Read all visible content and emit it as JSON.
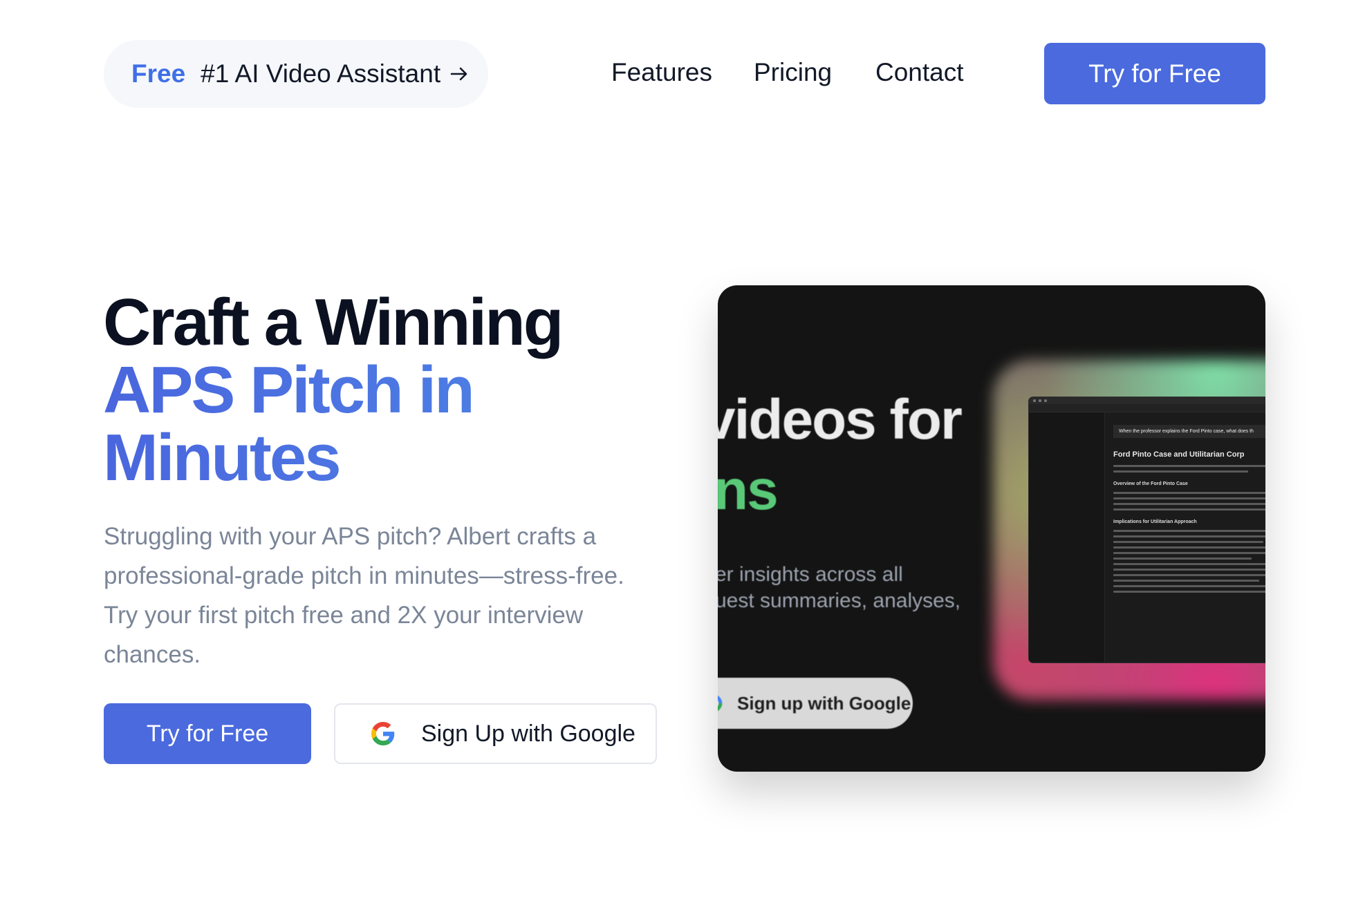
{
  "nav": {
    "promo": {
      "badge": "Free",
      "text": "#1 AI Video Assistant"
    },
    "links": [
      "Features",
      "Pricing",
      "Contact"
    ],
    "cta_label": "Try for Free"
  },
  "hero": {
    "title_line1": "Craft a Winning",
    "title_accent_line1": "APS Pitch in",
    "title_accent_line2": "Minutes",
    "description": "Struggling with your APS pitch? Albert crafts a professional-grade pitch in minutes—stress-free. Try your first pitch free and 2X your interview chances.",
    "primary_button": "Try for Free",
    "google_button": "Sign Up with Google"
  },
  "preview": {
    "headline": "videos for",
    "headline_fragment": "ns",
    "sub_line1": "er insights across all",
    "sub_line2": "uest summaries, analyses,",
    "google_pill": "Sign up with Google",
    "inner": {
      "question": "When the professor explains the Ford Pinto case, what does th",
      "title": "Ford Pinto Case and Utilitarian Corp",
      "heading1": "Overview of the Ford Pinto Case",
      "heading2": "Implications for Utilitarian Approach"
    }
  },
  "colors": {
    "accent": "#4a6ade",
    "promo_free": "#3f6fe6",
    "title_dark": "#0b1120",
    "description": "#7a8597",
    "preview_bg": "#141414",
    "preview_green": "#59c978"
  }
}
